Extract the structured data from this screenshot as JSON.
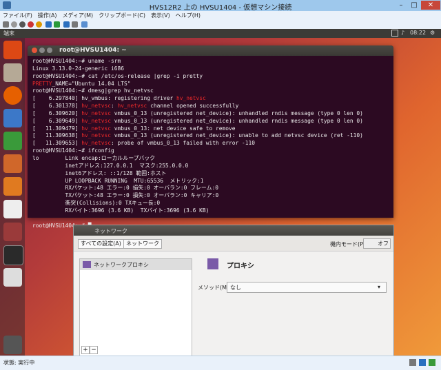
{
  "host": {
    "title": "HVS12R2 上の HVSU1404 - 仮想マシン接続",
    "win_min": "–",
    "win_max": "□",
    "win_close": "✕",
    "menu": [
      "ファイル(F)",
      "操作(A)",
      "メディア(M)",
      "クリップボード(C)",
      "表示(V)",
      "ヘルプ(H)"
    ],
    "status": "状態: 実行中"
  },
  "guest": {
    "app_name": "端末",
    "clock": "08:22",
    "launcher_icons": [
      "ubuntu-logo-icon",
      "files-icon",
      "firefox-icon",
      "writer-icon",
      "calc-icon",
      "impress-icon",
      "software-center-icon",
      "amazon-icon",
      "settings-icon",
      "terminal-icon",
      "disk-icon",
      "trash-icon"
    ]
  },
  "terminal": {
    "title": "root@HVSU1404: ~",
    "lines": [
      [
        {
          "t": "root@HVSU1404:~# uname -srm"
        }
      ],
      [
        {
          "t": "Linux 3.13.0-24-generic i686"
        }
      ],
      [
        {
          "t": "root@HVSU1404:~# cat /etc/os-release |grep -i pretty"
        }
      ],
      [
        {
          "t": "PRETTY",
          "c": "red"
        },
        {
          "t": "_NAME=\"Ubuntu 14.04 LTS\""
        }
      ],
      [
        {
          "t": "root@HVSU1404:~# dmesg|grep hv_netvsc"
        }
      ],
      [
        {
          "t": "[    6.297840] hv_vmbus: registering driver "
        },
        {
          "t": "hv_netvsc",
          "c": "red"
        }
      ],
      [
        {
          "t": "[    6.301378] "
        },
        {
          "t": "hv_netvsc",
          "c": "red"
        },
        {
          "t": ": "
        },
        {
          "t": "hv_netvsc",
          "c": "red"
        },
        {
          "t": " channel opened successfully"
        }
      ],
      [
        {
          "t": "[    6.309620] "
        },
        {
          "t": "hv_netvsc",
          "c": "red"
        },
        {
          "t": " vmbus_0_13 (unregistered net_device): unhandled rndis message (type 0 len 0)"
        }
      ],
      [
        {
          "t": "[    6.309649] "
        },
        {
          "t": "hv_netvsc",
          "c": "red"
        },
        {
          "t": " vmbus_0_13 (unregistered net_device): unhandled rndis message (type 0 len 0)"
        }
      ],
      [
        {
          "t": "[   11.309479] "
        },
        {
          "t": "hv_netvsc",
          "c": "red"
        },
        {
          "t": " vmbus_0_13: net device safe to remove"
        }
      ],
      [
        {
          "t": "[   11.309638] "
        },
        {
          "t": "hv_netvsc",
          "c": "red"
        },
        {
          "t": " vmbus_0_13 (unregistered net_device): unable to add netvsc device (ret -110)"
        }
      ],
      [
        {
          "t": "[   11.309653] "
        },
        {
          "t": "hv_netvsc",
          "c": "red"
        },
        {
          "t": ": probe of vmbus_0_13 failed with error -110"
        }
      ],
      [
        {
          "t": "root@HVSU1404:~# ifconfig"
        }
      ],
      [
        {
          "t": "lo        Link encap:ローカルループバック"
        }
      ],
      [
        {
          "t": "          inetアドレス:127.0.0.1  マスク:255.0.0.0"
        }
      ],
      [
        {
          "t": "          inet6アドレス: ::1/128 範囲:ホスト"
        }
      ],
      [
        {
          "t": "          UP LOOPBACK RUNNING  MTU:65536  メトリック:1"
        }
      ],
      [
        {
          "t": "          RXパケット:48 エラー:0 損失:0 オーバラン:0 フレーム:0"
        }
      ],
      [
        {
          "t": "          TXパケット:48 エラー:0 損失:0 オーバラン:0 キャリア:0"
        }
      ],
      [
        {
          "t": "          衝突(Collisions):0 TXキュー長:0"
        }
      ],
      [
        {
          "t": "          RXバイト:3696 (3.6 KB)  TXバイト:3696 (3.6 KB)"
        }
      ],
      [
        {
          "t": ""
        }
      ],
      [
        {
          "t": "root@HVSU1404:~# "
        },
        {
          "t": "█",
          "c": "cursor"
        }
      ]
    ]
  },
  "network": {
    "title": "ネットワーク",
    "all_settings": "すべての設定(A)",
    "crumb": "ネットワーク",
    "airplane_label": "機内モード(P)",
    "airplane_state": "オフ",
    "list_item": "ネットワークプロキシ",
    "add": "+",
    "remove": "−",
    "proxy_heading": "プロキシ",
    "method_label": "メソッド(M)",
    "method_value": "なし"
  }
}
